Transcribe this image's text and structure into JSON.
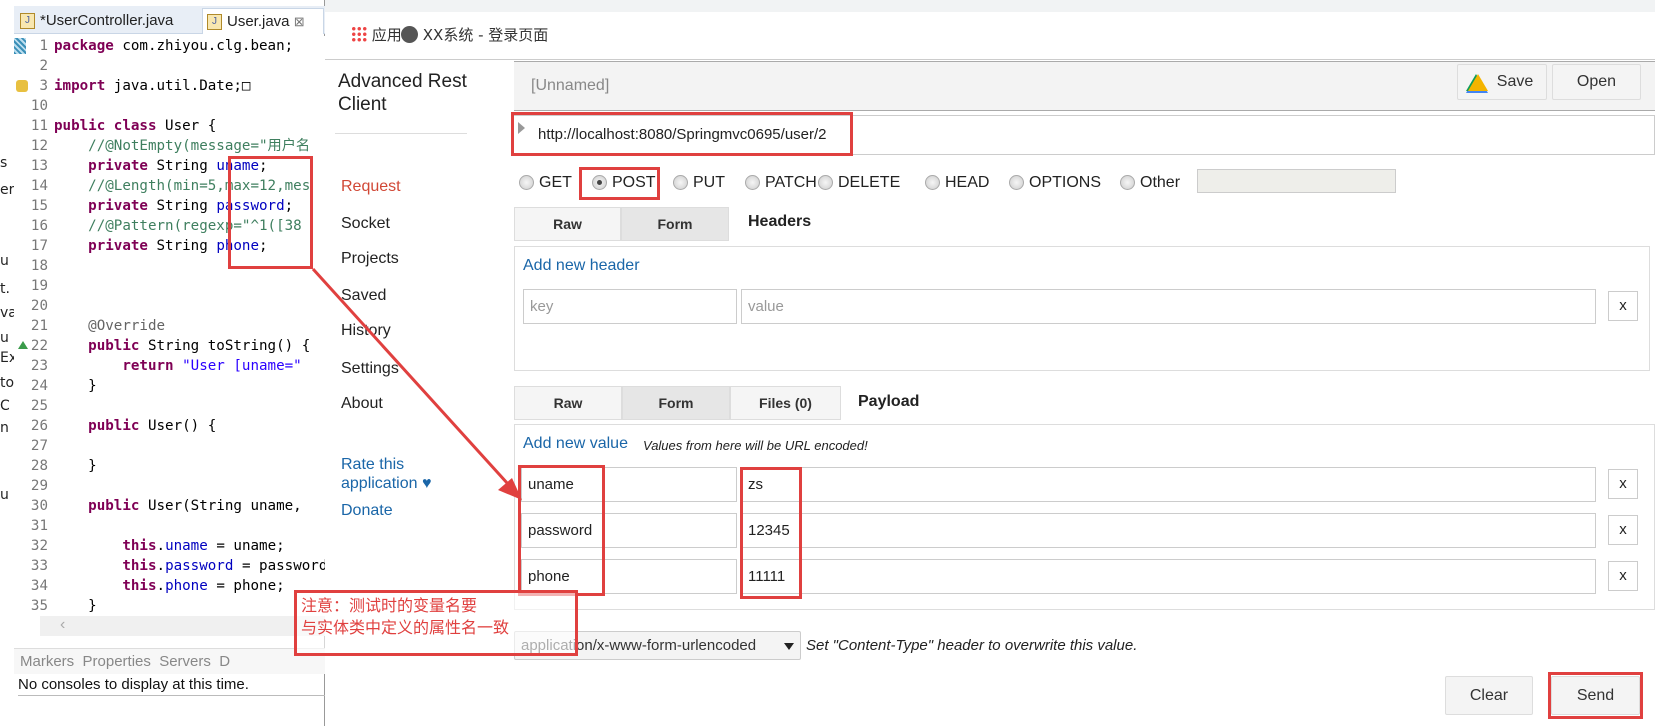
{
  "ide": {
    "tabs": [
      {
        "label": "*UserController.java"
      },
      {
        "label": "User.java",
        "close": "⊠"
      }
    ],
    "sliver_letters": [
      "s",
      "er",
      "u",
      "t.",
      "va",
      "u",
      "Ex",
      "to",
      "C",
      "n",
      "u"
    ],
    "code": [
      {
        "n": "1",
        "s": [
          [
            "kw",
            "package"
          ],
          [
            "pl",
            " com.zhiyou.clg.bean;"
          ]
        ]
      },
      {
        "n": "2",
        "s": []
      },
      {
        "n": "3",
        "s": [
          [
            "kw",
            "import"
          ],
          [
            "pl",
            " java.util.Date;□"
          ]
        ]
      },
      {
        "n": "10",
        "s": []
      },
      {
        "n": "11",
        "s": [
          [
            "kw",
            "public class"
          ],
          [
            "pl",
            " User {"
          ]
        ]
      },
      {
        "n": "12",
        "s": [
          [
            "pl",
            "    "
          ],
          [
            "cm",
            "//@NotEmpty(message=\"用户名"
          ]
        ]
      },
      {
        "n": "13",
        "s": [
          [
            "pl",
            "    "
          ],
          [
            "kw",
            "private"
          ],
          [
            "pl",
            " String "
          ],
          [
            "fld",
            "uname"
          ],
          [
            "pl",
            ";"
          ]
        ]
      },
      {
        "n": "14",
        "s": [
          [
            "pl",
            "    "
          ],
          [
            "cm",
            "//@Length(min=5,max=12,mes"
          ]
        ]
      },
      {
        "n": "15",
        "s": [
          [
            "pl",
            "    "
          ],
          [
            "kw",
            "private"
          ],
          [
            "pl",
            " String "
          ],
          [
            "fld",
            "password"
          ],
          [
            "pl",
            ";"
          ]
        ]
      },
      {
        "n": "16",
        "s": [
          [
            "pl",
            "    "
          ],
          [
            "cm",
            "//@Pattern(regexp=\"^1([38"
          ]
        ]
      },
      {
        "n": "17",
        "s": [
          [
            "pl",
            "    "
          ],
          [
            "kw",
            "private"
          ],
          [
            "pl",
            " String "
          ],
          [
            "fld",
            "phone"
          ],
          [
            "pl",
            ";"
          ]
        ]
      },
      {
        "n": "18",
        "s": []
      },
      {
        "n": "19",
        "s": []
      },
      {
        "n": "20",
        "s": []
      },
      {
        "n": "21",
        "s": [
          [
            "pl",
            "    "
          ],
          [
            "ann",
            "@Override"
          ]
        ]
      },
      {
        "n": "22",
        "s": [
          [
            "pl",
            "    "
          ],
          [
            "kw",
            "public"
          ],
          [
            "pl",
            " String toString() {"
          ]
        ]
      },
      {
        "n": "23",
        "s": [
          [
            "pl",
            "        "
          ],
          [
            "kw",
            "return"
          ],
          [
            "str",
            " \"User [uname=\""
          ]
        ]
      },
      {
        "n": "24",
        "s": [
          [
            "pl",
            "    }"
          ]
        ]
      },
      {
        "n": "25",
        "s": []
      },
      {
        "n": "26",
        "s": [
          [
            "pl",
            "    "
          ],
          [
            "kw",
            "public"
          ],
          [
            "pl",
            " User() {"
          ]
        ]
      },
      {
        "n": "27",
        "s": []
      },
      {
        "n": "28",
        "s": [
          [
            "pl",
            "    }"
          ]
        ]
      },
      {
        "n": "29",
        "s": []
      },
      {
        "n": "30",
        "s": [
          [
            "pl",
            "    "
          ],
          [
            "kw",
            "public"
          ],
          [
            "pl",
            " User(String uname,"
          ]
        ]
      },
      {
        "n": "31",
        "s": []
      },
      {
        "n": "32",
        "s": [
          [
            "pl",
            "        "
          ],
          [
            "kw",
            "this"
          ],
          [
            "pl",
            "."
          ],
          [
            "fld",
            "uname"
          ],
          [
            "pl",
            " = uname;"
          ]
        ]
      },
      {
        "n": "33",
        "s": [
          [
            "pl",
            "        "
          ],
          [
            "kw",
            "this"
          ],
          [
            "pl",
            "."
          ],
          [
            "fld",
            "password"
          ],
          [
            "pl",
            " = password"
          ]
        ]
      },
      {
        "n": "34",
        "s": [
          [
            "pl",
            "        "
          ],
          [
            "kw",
            "this"
          ],
          [
            "pl",
            "."
          ],
          [
            "fld",
            "phone"
          ],
          [
            "pl",
            " = phone;"
          ]
        ]
      },
      {
        "n": "35",
        "s": [
          [
            "pl",
            "    }"
          ]
        ]
      }
    ],
    "panel_tabs": "Markers  Properties  Servers  D",
    "console_text": "No consoles to display at this time."
  },
  "browser": {
    "bookmarks": [
      {
        "label": "应用",
        "icon": "apps-grid-icon"
      },
      {
        "label": "XX系统 - 登录页面",
        "icon": "globe-icon"
      }
    ]
  },
  "arc": {
    "title": "Advanced Rest Client",
    "nav": [
      "Request",
      "Socket",
      "Projects",
      "Saved",
      "History",
      "Settings",
      "About"
    ],
    "active_nav": "Request",
    "rate": "Rate this application ♥",
    "donate": "Donate",
    "request_name": "[Unnamed]",
    "save_label": "Save",
    "open_label": "Open",
    "url": "http://localhost:8080/Springmvc0695/user/2",
    "methods": [
      "GET",
      "POST",
      "PUT",
      "PATCH",
      "DELETE",
      "HEAD",
      "OPTIONS",
      "Other"
    ],
    "selected_method": "POST",
    "headers": {
      "tabs": [
        "Raw",
        "Form"
      ],
      "selected_tab": "Form",
      "label": "Headers",
      "add_label": "Add new header",
      "key_placeholder": "key",
      "value_placeholder": "value",
      "remove": "x"
    },
    "payload": {
      "tabs": [
        "Raw",
        "Form",
        "Files (0)"
      ],
      "selected_tab": "Form",
      "label": "Payload",
      "add_label": "Add new value",
      "note": "Values from here will be URL encoded!",
      "rows": [
        {
          "key": "uname",
          "value": "zs"
        },
        {
          "key": "password",
          "value": "12345"
        },
        {
          "key": "phone",
          "value": "11111"
        }
      ],
      "remove": "x",
      "content_type": "application/x-www-form-urlencoded",
      "content_type_note": "Set \"Content-Type\" header to overwrite this value."
    },
    "clear_label": "Clear",
    "send_label": "Send"
  },
  "annotation": {
    "line1": "注意：测试时的变量名要",
    "line2": "与实体类中定义的属性名一致",
    "color": "#e0403f"
  }
}
